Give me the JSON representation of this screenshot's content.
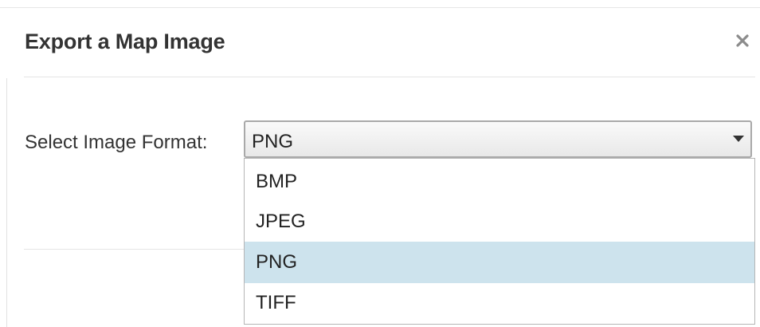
{
  "dialog": {
    "title": "Export a Map Image",
    "close_icon": "close-icon"
  },
  "form": {
    "format_label": "Select Image Format:",
    "selected_format": "PNG",
    "dropdown_icon": "caret-down-icon",
    "options": [
      "BMP",
      "JPEG",
      "PNG",
      "TIFF"
    ],
    "highlighted_option": "PNG"
  },
  "colors": {
    "highlight": "#cde3ed",
    "text": "#333333",
    "close_icon": "#8c8c8c"
  }
}
